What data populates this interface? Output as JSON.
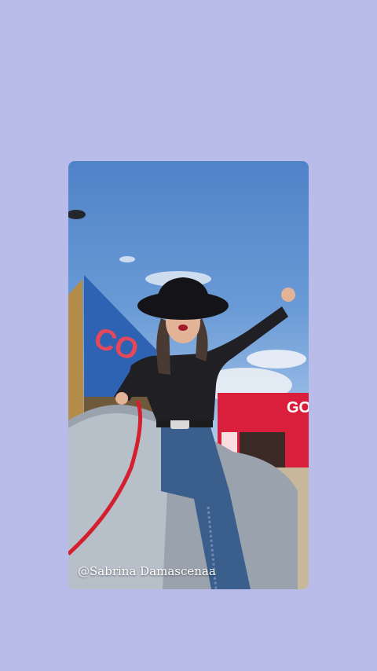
{
  "page": {
    "background_color": "#b9bce8"
  },
  "story": {
    "media_type": "photo",
    "signs": {
      "left_sign_text": "CO",
      "right_sign_text": "GO"
    },
    "caption": "@Sabrina Damascenaa"
  }
}
